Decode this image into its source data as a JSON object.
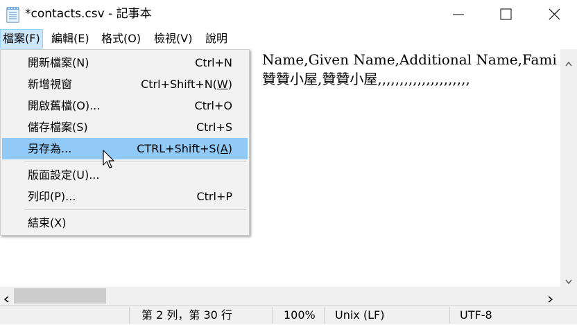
{
  "window": {
    "title": "*contacts.csv - 記事本",
    "buttons": {
      "minimize": "minimize",
      "maximize": "maximize",
      "close": "close"
    }
  },
  "menubar": [
    {
      "label": "檔案(F)",
      "active": true
    },
    {
      "label": "編輯(E)"
    },
    {
      "label": "格式(O)"
    },
    {
      "label": "檢視(V)"
    },
    {
      "label": "說明"
    }
  ],
  "file_menu": {
    "new": {
      "label": "開新檔案(N)",
      "shortcut": "Ctrl+N"
    },
    "new_window": {
      "label": "新增視窗",
      "shortcut_pre": "Ctrl+Shift+N(",
      "shortcut_u": "W",
      "shortcut_post": ")"
    },
    "open": {
      "label": "開啟舊檔(O)...",
      "shortcut": "Ctrl+O"
    },
    "save": {
      "label": "儲存檔案(S)",
      "shortcut": "Ctrl+S"
    },
    "save_as": {
      "label": "另存為...",
      "shortcut_pre": "CTRL+Shift+S(",
      "shortcut_u": "A",
      "shortcut_post": ")"
    },
    "page_setup": {
      "label": "版面設定(U)..."
    },
    "print": {
      "label": "列印(P)...",
      "shortcut": "Ctrl+P"
    },
    "exit": {
      "label": "結束(X)"
    }
  },
  "editor": {
    "line1": "Name,Given Name,Additional Name,Fami",
    "line2": "贊贊小屋,贊贊小屋,,,,,,,,,,,,,,,,,,,,,"
  },
  "statusbar": {
    "position": "第 2 列，第 30 行",
    "zoom": "100%",
    "line_ending": "Unix (LF)",
    "encoding": "UTF-8"
  },
  "colors": {
    "menu_highlight": "#91c9f7",
    "menubar_active": "#cce8ff",
    "status_bg": "#f0f0f0"
  }
}
